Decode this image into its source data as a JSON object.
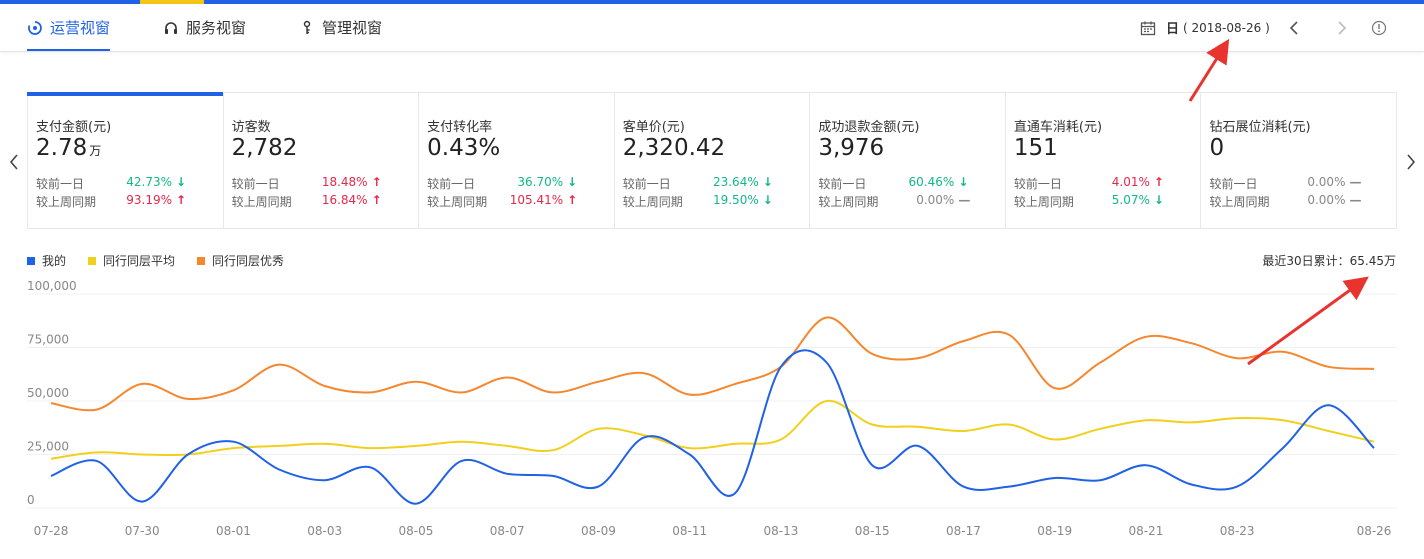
{
  "tabs": [
    {
      "label": "运营视窗",
      "icon": "operation-icon",
      "active": true
    },
    {
      "label": "服务视窗",
      "icon": "headset-icon",
      "active": false
    },
    {
      "label": "管理视窗",
      "icon": "key-icon",
      "active": false
    }
  ],
  "date": {
    "period": "日",
    "value": "( 2018-08-26 )"
  },
  "metrics": [
    {
      "title": "支付金额(元)",
      "value": "2.78",
      "unit": "万",
      "active": true,
      "rows": [
        {
          "label": "较前一日",
          "pct": "42.73%",
          "dir": "down"
        },
        {
          "label": "较上周同期",
          "pct": "93.19%",
          "dir": "up"
        }
      ]
    },
    {
      "title": "访客数",
      "value": "2,782",
      "unit": "",
      "rows": [
        {
          "label": "较前一日",
          "pct": "18.48%",
          "dir": "up"
        },
        {
          "label": "较上周同期",
          "pct": "16.84%",
          "dir": "up"
        }
      ]
    },
    {
      "title": "支付转化率",
      "value": "0.43%",
      "unit": "",
      "rows": [
        {
          "label": "较前一日",
          "pct": "36.70%",
          "dir": "down"
        },
        {
          "label": "较上周同期",
          "pct": "105.41%",
          "dir": "up"
        }
      ]
    },
    {
      "title": "客单价(元)",
      "value": "2,320.42",
      "unit": "",
      "rows": [
        {
          "label": "较前一日",
          "pct": "23.64%",
          "dir": "down"
        },
        {
          "label": "较上周同期",
          "pct": "19.50%",
          "dir": "down"
        }
      ]
    },
    {
      "title": "成功退款金额(元)",
      "value": "3,976",
      "unit": "",
      "rows": [
        {
          "label": "较前一日",
          "pct": "60.46%",
          "dir": "down"
        },
        {
          "label": "较上周同期",
          "pct": "0.00%",
          "dir": "flat"
        }
      ]
    },
    {
      "title": "直通车消耗(元)",
      "value": "151",
      "unit": "",
      "rows": [
        {
          "label": "较前一日",
          "pct": "4.01%",
          "dir": "up"
        },
        {
          "label": "较上周同期",
          "pct": "5.07%",
          "dir": "down"
        }
      ]
    },
    {
      "title": "钻石展位消耗(元)",
      "value": "0",
      "unit": "",
      "rows": [
        {
          "label": "较前一日",
          "pct": "0.00%",
          "dir": "flat"
        },
        {
          "label": "较上周同期",
          "pct": "0.00%",
          "dir": "flat"
        }
      ]
    }
  ],
  "arrows": {
    "up": "↑",
    "down": "↓",
    "flat": "—"
  },
  "cumulative": "最近30日累计：65.45万",
  "colors": {
    "accent": "#2062e6",
    "mine": "#2062e6",
    "avg": "#f2cf1d",
    "excellent": "#f5872e",
    "up": "#e6274a",
    "down": "#12b886"
  },
  "chart_data": {
    "type": "line",
    "x": [
      "07-28",
      "07-29",
      "07-30",
      "07-31",
      "08-01",
      "08-02",
      "08-03",
      "08-04",
      "08-05",
      "08-06",
      "08-07",
      "08-08",
      "08-09",
      "08-10",
      "08-11",
      "08-12",
      "08-13",
      "08-14",
      "08-15",
      "08-16",
      "08-17",
      "08-18",
      "08-19",
      "08-20",
      "08-21",
      "08-22",
      "08-23",
      "08-24",
      "08-25",
      "08-26"
    ],
    "xticks": [
      "07-28",
      "07-30",
      "08-01",
      "08-03",
      "08-05",
      "08-07",
      "08-09",
      "08-11",
      "08-13",
      "08-15",
      "08-17",
      "08-19",
      "08-21",
      "08-23",
      "08-26"
    ],
    "yticks": [
      "100,000",
      "75,000",
      "50,000",
      "25,000",
      "0"
    ],
    "ylim": [
      0,
      100000
    ],
    "series": [
      {
        "name": "我的",
        "color": "#2062e6",
        "values": [
          15000,
          22000,
          3000,
          25000,
          31000,
          18000,
          13000,
          19000,
          2000,
          22000,
          16000,
          15000,
          10000,
          33000,
          25000,
          7000,
          66000,
          68000,
          20000,
          29000,
          10000,
          10000,
          14000,
          13000,
          20000,
          11000,
          10000,
          28000,
          48000,
          28000
        ]
      },
      {
        "name": "同行同层平均",
        "color": "#f2cf1d",
        "values": [
          23000,
          26000,
          25000,
          25000,
          28000,
          29000,
          30000,
          28000,
          29000,
          31000,
          29000,
          27000,
          37000,
          34000,
          28000,
          30000,
          32000,
          50000,
          39000,
          38000,
          36000,
          39000,
          32000,
          37000,
          41000,
          40000,
          42000,
          41000,
          36000,
          31000
        ]
      },
      {
        "name": "同行同层优秀",
        "color": "#f5872e",
        "values": [
          49000,
          46000,
          58000,
          51000,
          55000,
          67000,
          57000,
          54000,
          59000,
          54000,
          61000,
          54000,
          59000,
          63000,
          53000,
          58000,
          66000,
          89000,
          72000,
          70000,
          78000,
          81000,
          56000,
          68000,
          80000,
          77000,
          70000,
          73000,
          66000,
          65000
        ]
      }
    ]
  }
}
